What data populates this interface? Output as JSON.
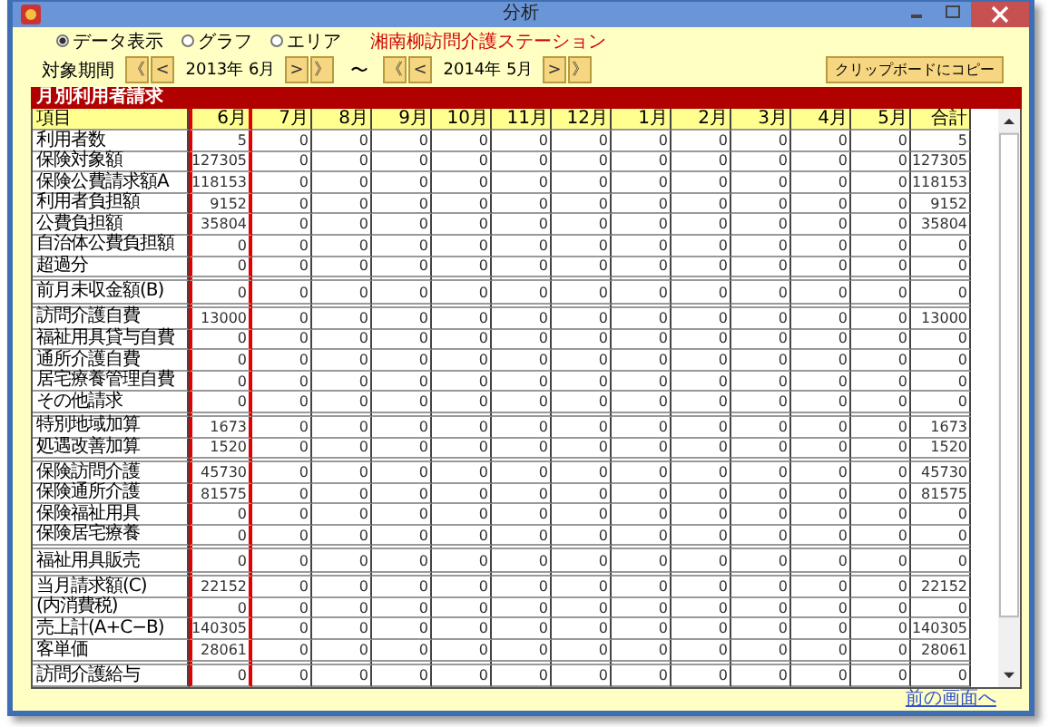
{
  "window": {
    "title": "分析"
  },
  "view_options": [
    {
      "label": "データ表示",
      "selected": true
    },
    {
      "label": "グラフ",
      "selected": false
    },
    {
      "label": "エリア",
      "selected": false
    }
  ],
  "facility_name": "湘南柳訪問介護ステーション",
  "period": {
    "label": "対象期間",
    "from": {
      "first": "《",
      "prev": "<",
      "value": "2013年 6月",
      "next": ">",
      "last": "》"
    },
    "separator": "〜",
    "to": {
      "first": "《",
      "prev": "<",
      "value": "2014年 5月",
      "next": ">",
      "last": "》"
    }
  },
  "copy_button": "クリップボードにコピー",
  "section_title": "月別利用者請求",
  "table": {
    "columns": [
      {
        "label": "項目",
        "highlighted": false
      },
      {
        "label": "6月",
        "highlighted": true
      },
      {
        "label": "7月",
        "highlighted": false
      },
      {
        "label": "8月",
        "highlighted": false
      },
      {
        "label": "9月",
        "highlighted": false
      },
      {
        "label": "10月",
        "highlighted": false
      },
      {
        "label": "11月",
        "highlighted": false
      },
      {
        "label": "12月",
        "highlighted": false
      },
      {
        "label": "1月",
        "highlighted": false
      },
      {
        "label": "2月",
        "highlighted": false
      },
      {
        "label": "3月",
        "highlighted": false
      },
      {
        "label": "4月",
        "highlighted": false
      },
      {
        "label": "5月",
        "highlighted": false
      },
      {
        "label": "合計",
        "highlighted": false
      }
    ],
    "rows": [
      {
        "kind": "data",
        "label": "利用者数",
        "values": [
          "5",
          "0",
          "0",
          "0",
          "0",
          "0",
          "0",
          "0",
          "0",
          "0",
          "0",
          "0",
          "5"
        ]
      },
      {
        "kind": "data",
        "label": "保険対象額",
        "values": [
          "127305",
          "0",
          "0",
          "0",
          "0",
          "0",
          "0",
          "0",
          "0",
          "0",
          "0",
          "0",
          "127305"
        ]
      },
      {
        "kind": "data",
        "label": "保険公費請求額A",
        "values": [
          "118153",
          "0",
          "0",
          "0",
          "0",
          "0",
          "0",
          "0",
          "0",
          "0",
          "0",
          "0",
          "118153"
        ]
      },
      {
        "kind": "data",
        "label": "利用者負担額",
        "values": [
          "9152",
          "0",
          "0",
          "0",
          "0",
          "0",
          "0",
          "0",
          "0",
          "0",
          "0",
          "0",
          "9152"
        ]
      },
      {
        "kind": "data",
        "label": "公費負担額",
        "values": [
          "35804",
          "0",
          "0",
          "0",
          "0",
          "0",
          "0",
          "0",
          "0",
          "0",
          "0",
          "0",
          "35804"
        ]
      },
      {
        "kind": "data",
        "label": "自治体公費負担額",
        "values": [
          "0",
          "0",
          "0",
          "0",
          "0",
          "0",
          "0",
          "0",
          "0",
          "0",
          "0",
          "0",
          "0"
        ]
      },
      {
        "kind": "data",
        "label": "超過分",
        "values": [
          "0",
          "0",
          "0",
          "0",
          "0",
          "0",
          "0",
          "0",
          "0",
          "0",
          "0",
          "0",
          "0"
        ]
      },
      {
        "kind": "spacer"
      },
      {
        "kind": "tall",
        "label": "前月未収金額(B)",
        "values": [
          "0",
          "0",
          "0",
          "0",
          "0",
          "0",
          "0",
          "0",
          "0",
          "0",
          "0",
          "0",
          "0"
        ]
      },
      {
        "kind": "spacer"
      },
      {
        "kind": "data",
        "label": "訪問介護自費",
        "values": [
          "13000",
          "0",
          "0",
          "0",
          "0",
          "0",
          "0",
          "0",
          "0",
          "0",
          "0",
          "0",
          "13000"
        ]
      },
      {
        "kind": "data",
        "label": "福祉用具貸与自費",
        "values": [
          "0",
          "0",
          "0",
          "0",
          "0",
          "0",
          "0",
          "0",
          "0",
          "0",
          "0",
          "0",
          "0"
        ]
      },
      {
        "kind": "data",
        "label": "通所介護自費",
        "values": [
          "0",
          "0",
          "0",
          "0",
          "0",
          "0",
          "0",
          "0",
          "0",
          "0",
          "0",
          "0",
          "0"
        ]
      },
      {
        "kind": "data",
        "label": "居宅療養管理自費",
        "values": [
          "0",
          "0",
          "0",
          "0",
          "0",
          "0",
          "0",
          "0",
          "0",
          "0",
          "0",
          "0",
          "0"
        ]
      },
      {
        "kind": "data",
        "label": "その他請求",
        "values": [
          "0",
          "0",
          "0",
          "0",
          "0",
          "0",
          "0",
          "0",
          "0",
          "0",
          "0",
          "0",
          "0"
        ]
      },
      {
        "kind": "spacer"
      },
      {
        "kind": "data",
        "label": "特別地域加算",
        "values": [
          "1673",
          "0",
          "0",
          "0",
          "0",
          "0",
          "0",
          "0",
          "0",
          "0",
          "0",
          "0",
          "1673"
        ]
      },
      {
        "kind": "data",
        "label": "処遇改善加算",
        "values": [
          "1520",
          "0",
          "0",
          "0",
          "0",
          "0",
          "0",
          "0",
          "0",
          "0",
          "0",
          "0",
          "1520"
        ]
      },
      {
        "kind": "spacer"
      },
      {
        "kind": "data",
        "label": "保険訪問介護",
        "values": [
          "45730",
          "0",
          "0",
          "0",
          "0",
          "0",
          "0",
          "0",
          "0",
          "0",
          "0",
          "0",
          "45730"
        ]
      },
      {
        "kind": "data",
        "label": "保険通所介護",
        "values": [
          "81575",
          "0",
          "0",
          "0",
          "0",
          "0",
          "0",
          "0",
          "0",
          "0",
          "0",
          "0",
          "81575"
        ]
      },
      {
        "kind": "data",
        "label": "保険福祉用具",
        "values": [
          "0",
          "0",
          "0",
          "0",
          "0",
          "0",
          "0",
          "0",
          "0",
          "0",
          "0",
          "0",
          "0"
        ]
      },
      {
        "kind": "data",
        "label": "保険居宅療養",
        "values": [
          "0",
          "0",
          "0",
          "0",
          "0",
          "0",
          "0",
          "0",
          "0",
          "0",
          "0",
          "0",
          "0"
        ]
      },
      {
        "kind": "spacer"
      },
      {
        "kind": "tall",
        "label": "福祉用具販売",
        "values": [
          "0",
          "0",
          "0",
          "0",
          "0",
          "0",
          "0",
          "0",
          "0",
          "0",
          "0",
          "0",
          "0"
        ]
      },
      {
        "kind": "spacer"
      },
      {
        "kind": "data",
        "label": "当月請求額(C)",
        "values": [
          "22152",
          "0",
          "0",
          "0",
          "0",
          "0",
          "0",
          "0",
          "0",
          "0",
          "0",
          "0",
          "22152"
        ]
      },
      {
        "kind": "data",
        "label": "(内消費税)",
        "values": [
          "0",
          "0",
          "0",
          "0",
          "0",
          "0",
          "0",
          "0",
          "0",
          "0",
          "0",
          "0",
          "0"
        ]
      },
      {
        "kind": "data",
        "label": "売上計(A+C−B)",
        "values": [
          "140305",
          "0",
          "0",
          "0",
          "0",
          "0",
          "0",
          "0",
          "0",
          "0",
          "0",
          "0",
          "140305"
        ]
      },
      {
        "kind": "data",
        "label": "客単価",
        "values": [
          "28061",
          "0",
          "0",
          "0",
          "0",
          "0",
          "0",
          "0",
          "0",
          "0",
          "0",
          "0",
          "28061"
        ]
      },
      {
        "kind": "spacer"
      },
      {
        "kind": "tall",
        "label": "訪問介護給与",
        "values": [
          "0",
          "0",
          "0",
          "0",
          "0",
          "0",
          "0",
          "0",
          "0",
          "0",
          "0",
          "0",
          "0"
        ]
      }
    ]
  },
  "back_link": "前の画面へ"
}
